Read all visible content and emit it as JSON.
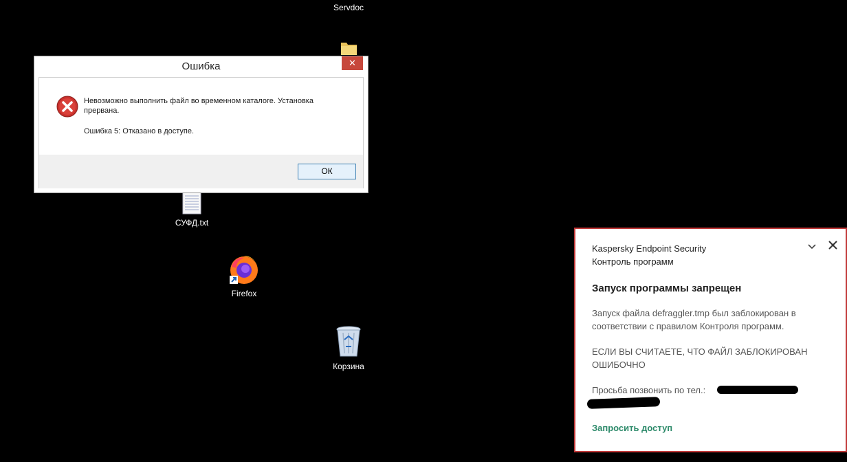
{
  "desktop": {
    "icons": [
      {
        "label": "Servdoc",
        "icon": "folder-icon"
      },
      {
        "label": "СУФД.txt",
        "icon": "text-file-icon"
      },
      {
        "label": "Firefox",
        "icon": "firefox-icon"
      },
      {
        "label": "Корзина",
        "icon": "recycle-bin-icon"
      }
    ]
  },
  "error_dialog": {
    "title": "Ошибка",
    "close_label": "✕",
    "message_line1": "Невозможно выполнить файл во временном каталоге. Установка прервана.",
    "message_line2": "Ошибка 5: Отказано в доступе.",
    "ok_label": "ОК",
    "icon": "error-icon"
  },
  "kaspersky": {
    "app_name": "Kaspersky Endpoint Security",
    "component": "Контроль программ",
    "heading": "Запуск программы запрещен",
    "text1": "Запуск файла defraggler.tmp был заблокирован в соответствии с правилом Контроля программ.",
    "text2": "ЕСЛИ ВЫ СЧИТАЕТЕ, ЧТО ФАЙЛ ЗАБЛОКИРОВАН ОШИБОЧНО",
    "text3": "Просьба позвонить по тел.:",
    "request_link": "Запросить доступ",
    "collapse_icon": "chevron-down-icon",
    "close_icon": "close-icon"
  }
}
